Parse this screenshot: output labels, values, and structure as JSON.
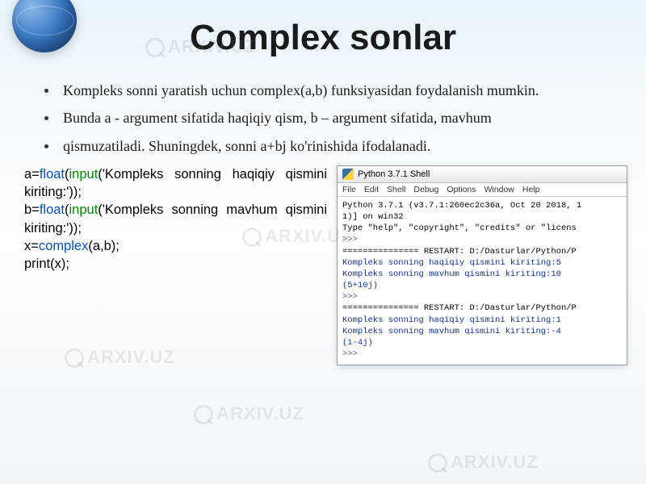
{
  "title": "Complex sonlar",
  "bullets": [
    "Kompleks sonni yaratish uchun complex(a,b) funksiyasidan foydalanish mumkin.",
    "Bunda a - argument sifatida haqiqiy qism, b – argument sifatida, mavhum",
    "qismuzatiladi. Shuningdek, sonni a+bj ko'rinishida ifodalanadi."
  ],
  "code": {
    "l1a": "a=",
    "l1b": "float",
    "l1c": "(",
    "l1d": "input",
    "l1e": "('Kompleks sonning haqiqiy qismini kiriting:'));",
    "l2a": "b=",
    "l2b": "float",
    "l2c": "(",
    "l2d": "input",
    "l2e": "('Kompleks sonning mavhum qismini kiriting:'));",
    "l3a": "x=",
    "l3b": "complex",
    "l3c": "(a,b);",
    "l4": "print(x);"
  },
  "shell": {
    "title": "Python 3.7.1 Shell",
    "menu": [
      "File",
      "Edit",
      "Shell",
      "Debug",
      "Options",
      "Window",
      "Help"
    ],
    "header1": "Python 3.7.1 (v3.7.1:260ec2c36a, Oct 20 2018, 1",
    "header2": "1)] on win32",
    "header3": "Type \"help\", \"copyright\", \"credits\" or \"licens",
    "prompt": ">>>",
    "restart": "=============== RESTART: D:/Dasturlar/Python/P",
    "run1_line1": "Kompleks sonning haqiqiy qismini kiriting:5",
    "run1_line2": "Kompleks sonning mavhum qismini kiriting:10",
    "run1_result": "(5+10j)",
    "run2_line1": "Kompleks sonning haqiqiy qismini kiriting:1",
    "run2_line2": "Kompleks sonning mavhum qismini kiriting:-4",
    "run2_result": "(1-4j)"
  },
  "watermark": "ARXIV.UZ"
}
